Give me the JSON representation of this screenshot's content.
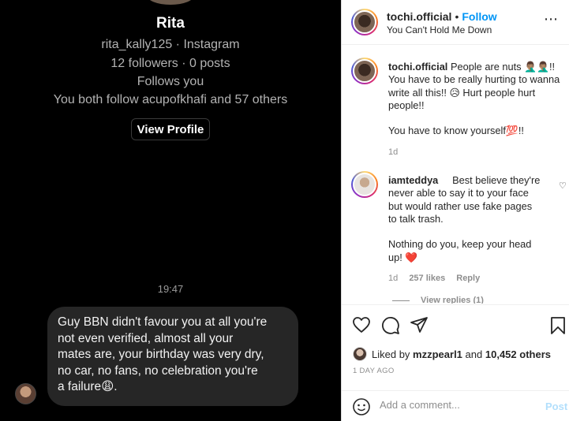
{
  "dm": {
    "name": "Rita",
    "handle_line": "rita_kally125 · Instagram",
    "stats_line": "12 followers · 0 posts",
    "follows_line": "Follows you",
    "mutual_line": "You both follow acupofkhafi and 57 others",
    "view_profile_label": "View Profile",
    "timestamp": "19:47",
    "message_lines": [
      "Guy BBN didn't favour you at all you're",
      "not even verified, almost all your",
      "mates are, your birthday was very dry,",
      "no car, no fans, no celebration you're",
      "a failure😩."
    ]
  },
  "post": {
    "username": "tochi.official",
    "dot": "•",
    "follow_label": "Follow",
    "subtitle": "You Can't Hold Me Down",
    "more_icon": "more-horizontal-icon",
    "comments": [
      {
        "username": "tochi.official",
        "lines": [
          "People are nuts 🤦🏽‍♂️🤦🏽‍♂️!!",
          "You have to be really hurting to wanna",
          "write all this!! 😥 Hurt people hurt",
          "people!!",
          "",
          "You have to know yourself💯!!"
        ],
        "age": "1d"
      },
      {
        "username": "iamteddya",
        "lines": [
          "Best believe they're",
          "never able to say it to your face",
          "but would rather use fake pages",
          "to talk trash.",
          "",
          "Nothing do you, keep your head",
          "up! ❤️"
        ],
        "age": "1d",
        "likes": "257 likes",
        "reply_label": "Reply",
        "view_replies": "View replies (1)"
      }
    ],
    "liked_prefix": "Liked by",
    "liked_user": "mzzpearl1",
    "liked_and": "and",
    "liked_count": "10,452 others",
    "date": "1 DAY AGO",
    "comment_placeholder": "Add a comment...",
    "post_label": "Post",
    "colors": {
      "follow": "#0095f6",
      "post_disabled": "#b2dffc",
      "dm_bubble": "#262626"
    }
  }
}
